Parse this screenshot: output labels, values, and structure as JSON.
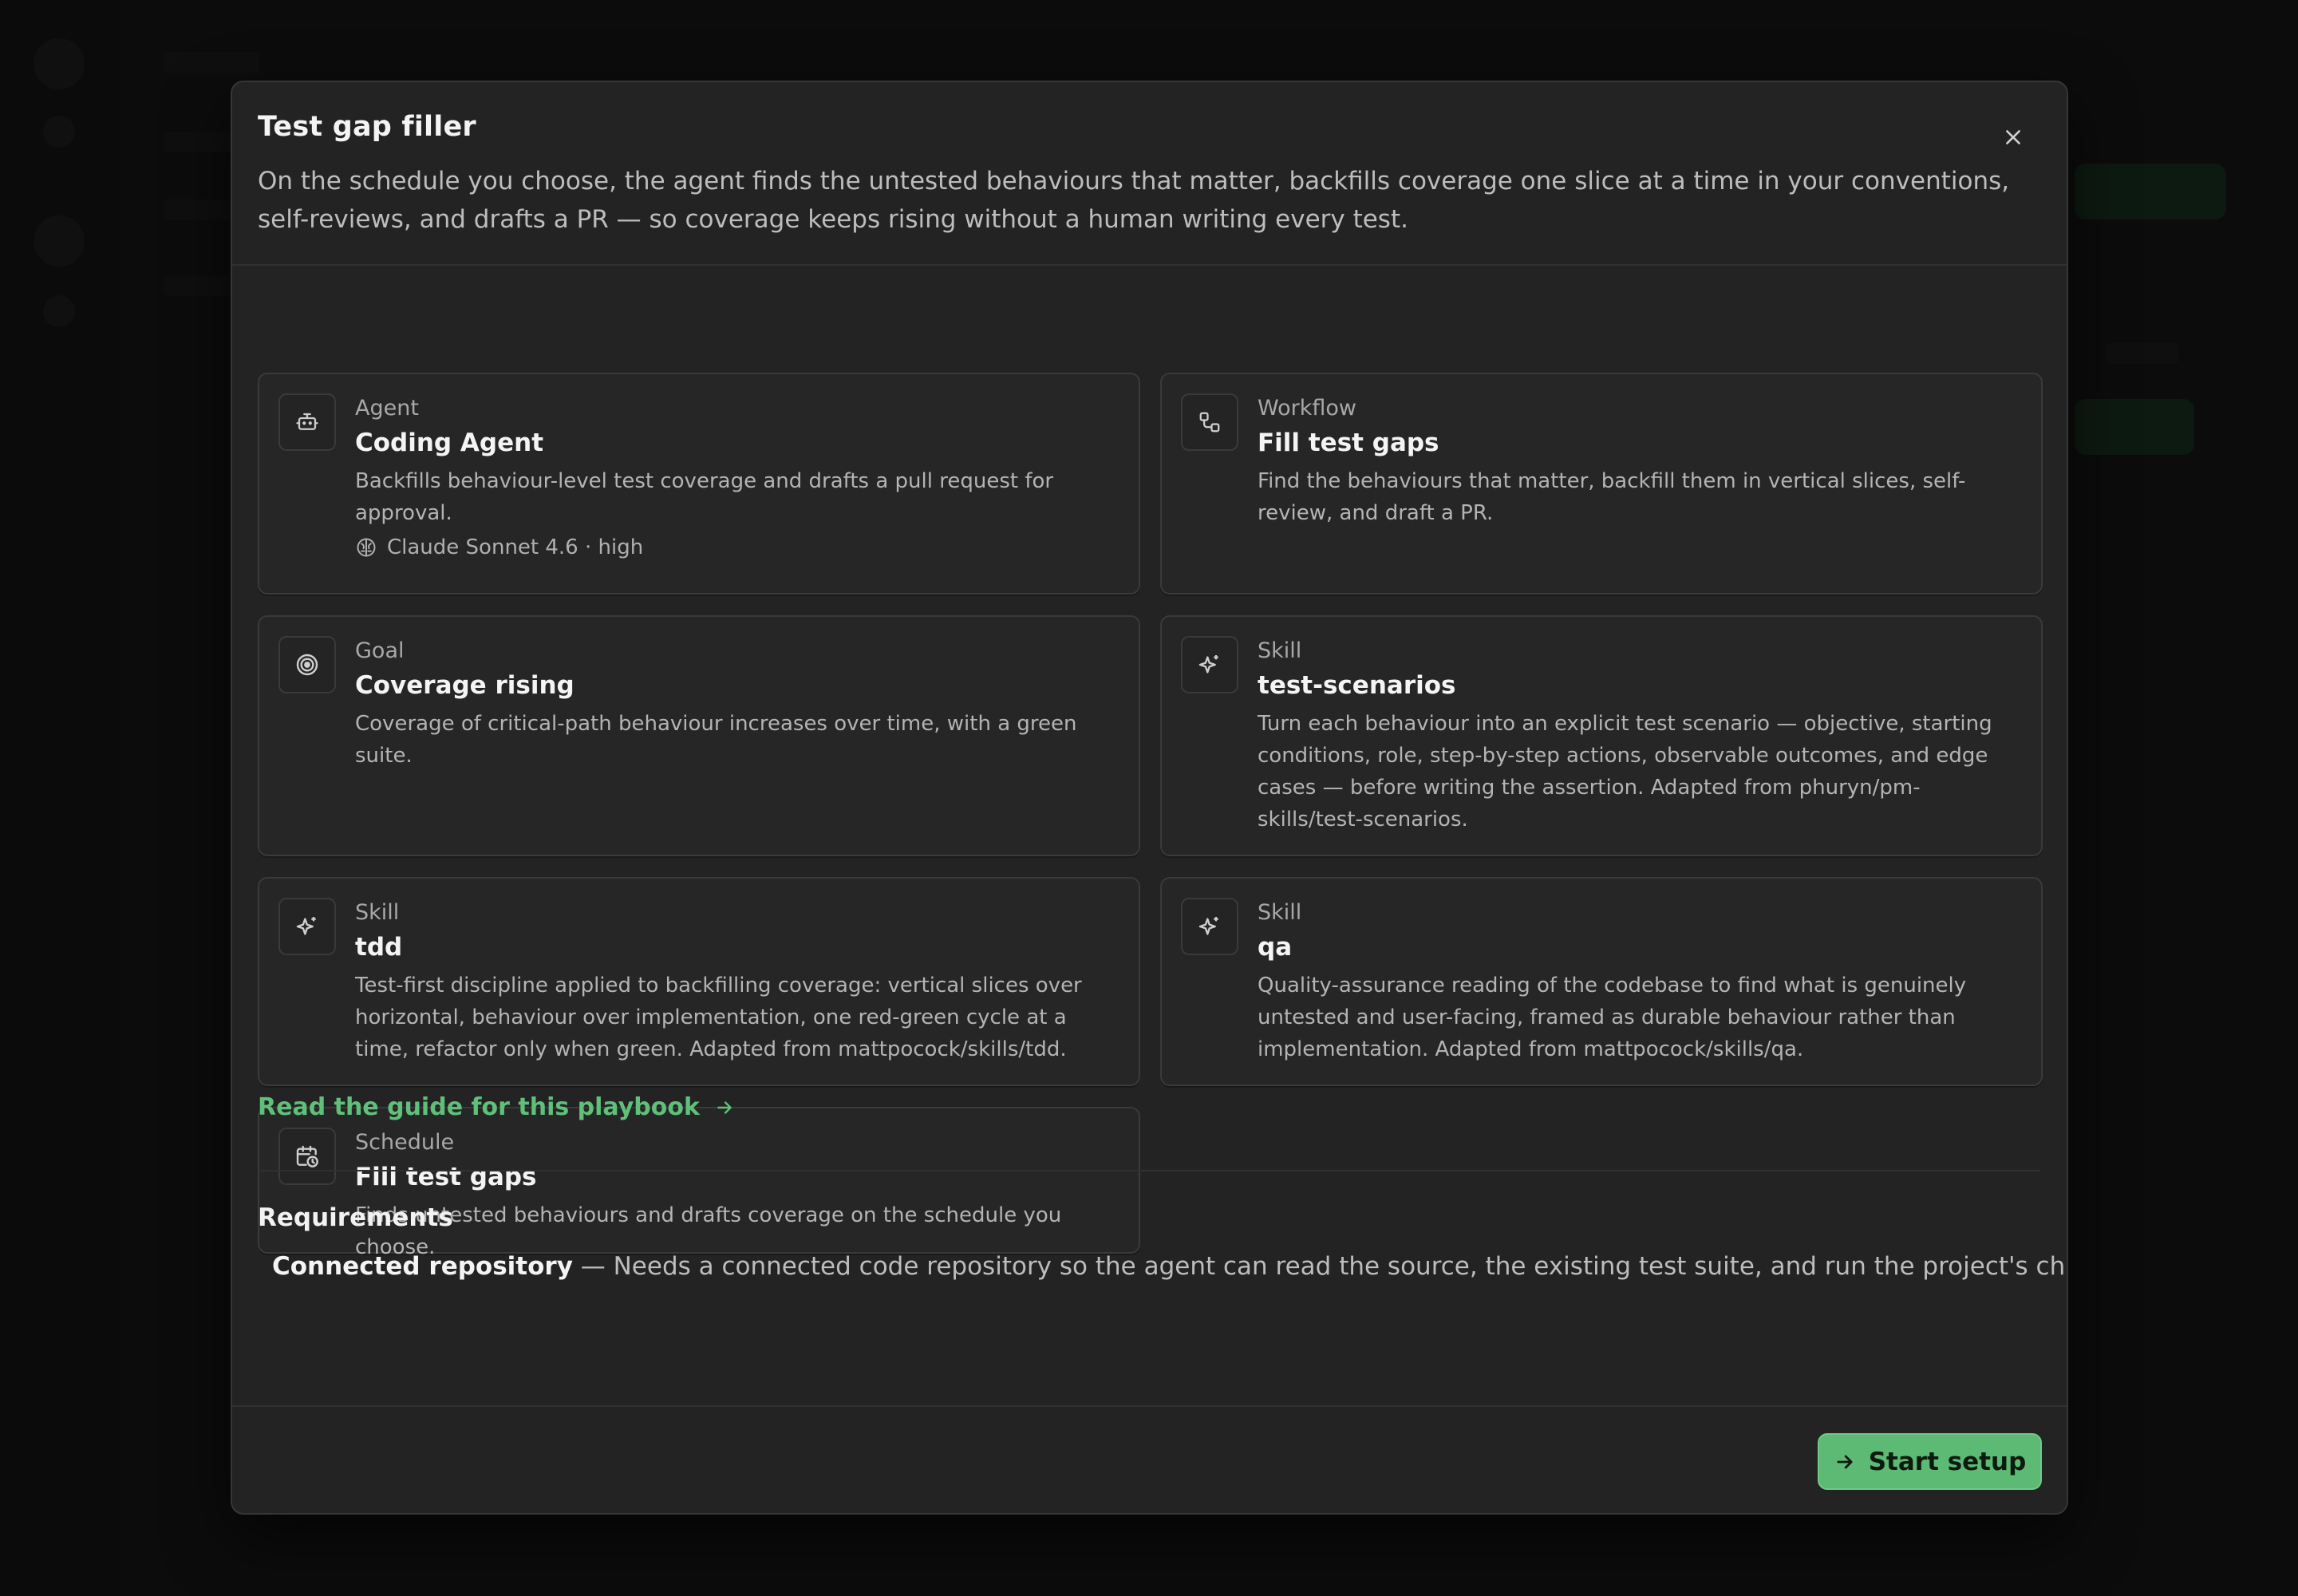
{
  "modal": {
    "title": "Test gap filler",
    "description": "On the schedule you choose, the agent finds the untested behaviours that matter, backfills coverage one slice at a time in your conventions, self-reviews, and drafts a PR — so coverage keeps rising without a human writing every test."
  },
  "cards": [
    {
      "kind": "Agent",
      "name": "Coding Agent",
      "body": "Backfills behaviour-level test coverage and drafts a pull request for approval.",
      "meta": "Claude Sonnet 4.6 · high",
      "icon": "robot-icon"
    },
    {
      "kind": "Workflow",
      "name": "Fill test gaps",
      "body": "Find the behaviours that matter, backfill them in vertical slices, self-review, and draft a PR.",
      "icon": "workflow-icon"
    },
    {
      "kind": "Goal",
      "name": "Coverage rising",
      "body": "Coverage of critical-path behaviour increases over time, with a green suite.",
      "icon": "target-icon"
    },
    {
      "kind": "Skill",
      "name": "test-scenarios",
      "body": "Turn each behaviour into an explicit test scenario — objective, starting conditions, role, step-by-step actions, observable outcomes, and edge cases — before writing the assertion. Adapted from phuryn/pm-skills/test-scenarios.",
      "icon": "sparkle-icon"
    },
    {
      "kind": "Skill",
      "name": "tdd",
      "body": "Test-first discipline applied to backfilling coverage: vertical slices over horizontal, behaviour over implementation, one red-green cycle at a time, refactor only when green. Adapted from mattpocock/skills/tdd.",
      "icon": "sparkle-icon"
    },
    {
      "kind": "Skill",
      "name": "qa",
      "body": "Quality-assurance reading of the codebase to find what is genuinely untested and user-facing, framed as durable behaviour rather than implementation. Adapted from mattpocock/skills/qa.",
      "icon": "sparkle-icon"
    },
    {
      "kind": "Schedule",
      "name": "Fill test gaps",
      "body": "Finds untested behaviours and drafts coverage on the schedule you choose.",
      "icon": "calendar-clock-icon"
    }
  ],
  "guide_link": "Read the guide for this playbook",
  "requirements": {
    "title": "Requirements",
    "items": [
      {
        "name": "Connected repository",
        "text": " — Needs a connected code repository so the agent can read the source, the existing test suite, and run the project's checks while"
      }
    ]
  },
  "footer": {
    "start_label": "Start setup"
  },
  "colors": {
    "accent": "#5cba74",
    "link": "#5fc07a",
    "surface": "#232323",
    "card": "#262626"
  }
}
